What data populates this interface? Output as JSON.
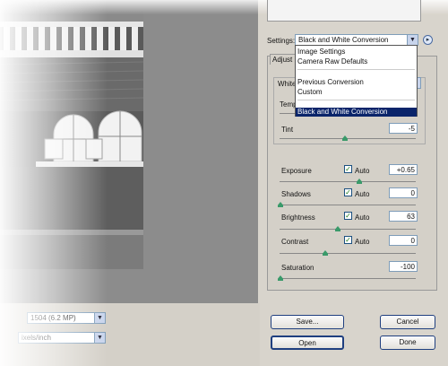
{
  "settings": {
    "label": "Settings:",
    "value": "Black and White Conversion",
    "options": [
      "Image Settings",
      "Camera Raw Defaults",
      "Previous Conversion",
      "Custom",
      "Black and White Conversion"
    ]
  },
  "tabs": {
    "active": "Adjust"
  },
  "white_balance": {
    "label_partial": "White",
    "temp_partial": "Temp",
    "tint_label": "Tint",
    "tint_value": "-5"
  },
  "adjustments": [
    {
      "label": "Exposure",
      "auto": true,
      "auto_label": "Auto",
      "value": "+0.65"
    },
    {
      "label": "Shadows",
      "auto": true,
      "auto_label": "Auto",
      "value": "0"
    },
    {
      "label": "Brightness",
      "auto": true,
      "auto_label": "Auto",
      "value": "63"
    },
    {
      "label": "Contrast",
      "auto": true,
      "auto_label": "Auto",
      "value": "0"
    },
    {
      "label": "Saturation",
      "value": "-100"
    }
  ],
  "footer": {
    "size_partial": "1504 (6.2 MP)",
    "resolution_partial": "ixels/inch"
  },
  "buttons": {
    "save": "Save...",
    "cancel": "Cancel",
    "open": "Open",
    "done": "Done"
  },
  "icons": {
    "dropdown": "chevron-down-icon",
    "menu": "right-arrow-circle-icon",
    "checkmark": "checkmark-icon"
  },
  "colors": {
    "selection": "#0a246a",
    "slider_thumb": "#3a9a6a"
  }
}
